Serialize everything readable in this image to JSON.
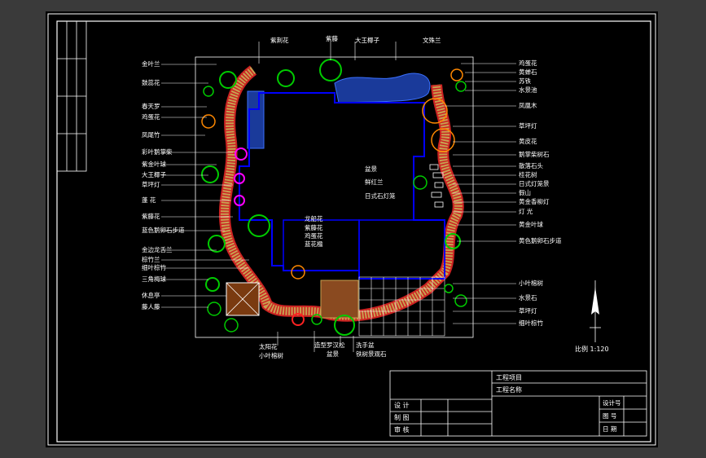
{
  "labels_left": [
    "金叶兰",
    "鼓蕊花",
    "春天罗",
    "鸡蛋花",
    "凤尾竹",
    "彩叶鹅掌柴",
    "紫金叶球",
    "大王椰子",
    "草坪灯",
    "蓬 花",
    "紫藤花",
    "蓝色鹅卵石步道",
    "金边龙舌兰",
    "棕竹兰",
    "细叶棕竹",
    "三角梅球",
    "休息亭",
    "藤人藤"
  ],
  "labels_top": [
    "紫荆花",
    "紫藤",
    "大王椰子",
    "文殊兰"
  ],
  "labels_right": [
    "鸡蛋花",
    "黄蝉石",
    "苏铁",
    "水景池",
    "凤凰木",
    "草坪灯",
    "黄皮花",
    "鹅掌柴树石",
    "散落石头",
    "桂花树",
    "日式灯笼景",
    "假山",
    "黄金香柳灯",
    "灯 光",
    "黄金叶球",
    "黄色鹅卵石步道",
    "小叶榕树",
    "水景石",
    "草坪灯",
    "细叶棕竹"
  ],
  "labels_inner": [
    "龙船花",
    "紫藤花",
    "鸡蛋花",
    "蓝花楹",
    "盆景",
    "鲜红兰",
    "日式石灯笼"
  ],
  "labels_bottom": [
    "太阳花",
    "小叶榕树",
    "造型罗汉松",
    "盆景",
    "洗手盆",
    "铁树景观石"
  ],
  "scale_label": "比例 1:120",
  "title_block": {
    "project_label": "工程项目",
    "name_label": "工程名称",
    "design_label": "设 计",
    "draw_label": "制 图",
    "review_label": "审 核",
    "drawing_no_label": "设计号",
    "sheet_no_label": "图 号",
    "date_label": "日 期"
  },
  "colors": {
    "background": "#000000",
    "frame": "#ffffff",
    "building": "#0000ff",
    "path_tan": "#c8a050",
    "path_red": "#cc2222",
    "water": "#1a3a9a",
    "plant_green": "#00cc00",
    "plant_pink": "#ff00ff"
  }
}
